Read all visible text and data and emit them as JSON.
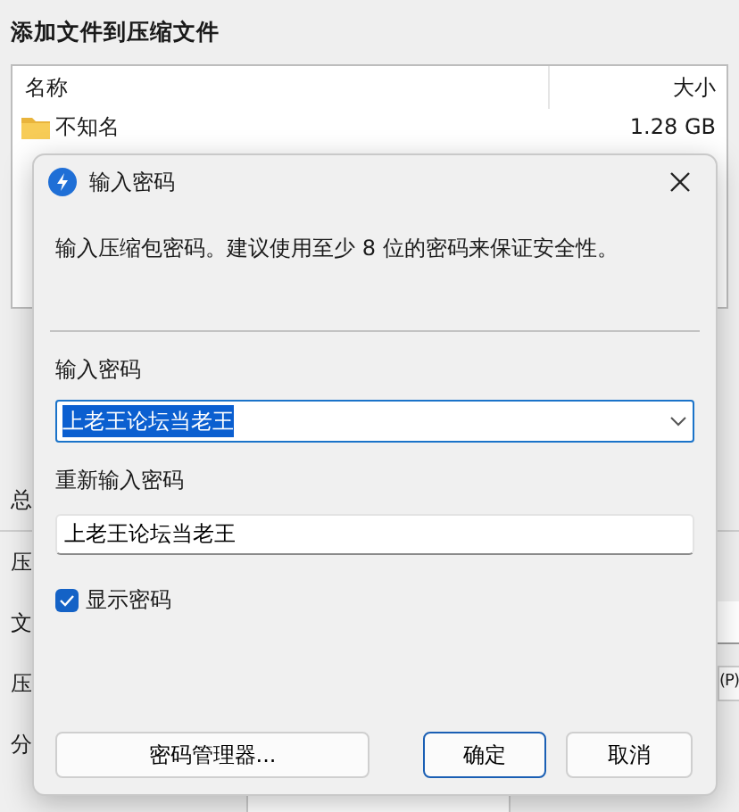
{
  "window": {
    "title": "添加文件到压缩文件"
  },
  "file_list": {
    "columns": [
      "名称",
      "大小"
    ],
    "rows": [
      {
        "name": "不知名",
        "size": "1.28 GB"
      }
    ]
  },
  "background_labels": [
    "总",
    "压",
    "文",
    "压",
    "分"
  ],
  "background_button_fragment": "(P)",
  "dialog": {
    "title": "输入密码",
    "description": "输入压缩包密码。建议使用至少 8 位的密码来保证安全性。",
    "password_label": "输入密码",
    "password": "上老王论坛当老王",
    "password_selected": true,
    "confirm_label": "重新输入密码",
    "confirm": "上老王论坛当老王",
    "show_password": {
      "label": "显示密码",
      "checked": true
    },
    "buttons": [
      {
        "label": "密码管理器...",
        "default": false
      },
      {
        "label": "确定",
        "default": true
      },
      {
        "label": "取消",
        "default": false
      }
    ]
  }
}
